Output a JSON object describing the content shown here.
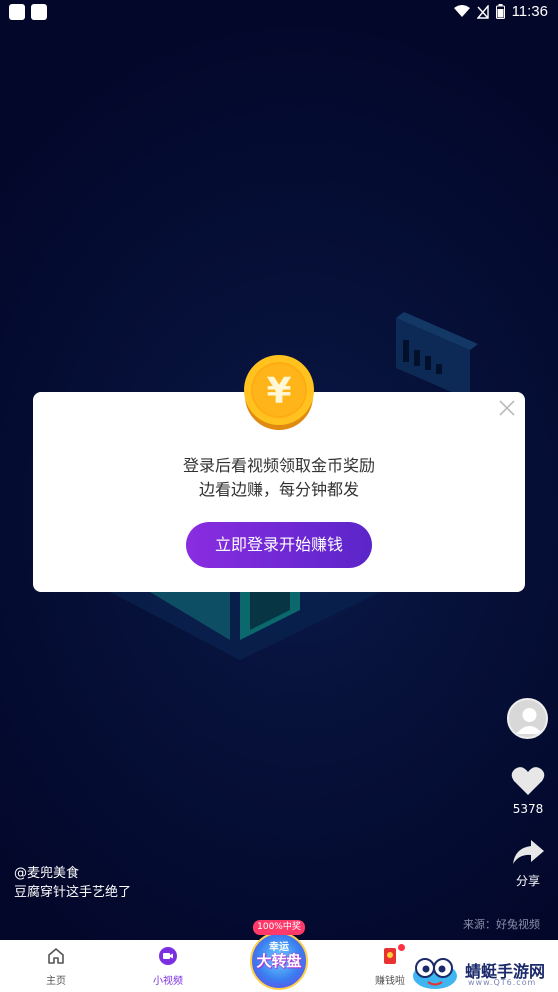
{
  "status_bar": {
    "time": "11:36"
  },
  "modal": {
    "line1": "登录后看视频领取金币奖励",
    "line2": "边看边赚，每分钟都发",
    "button_label": "立即登录开始赚钱"
  },
  "side_actions": {
    "like_count": "5378",
    "share_label": "分享"
  },
  "video": {
    "author": "@麦兜美食",
    "description": "豆腐穿针这手艺绝了",
    "source": "来源：好兔视频"
  },
  "nav": {
    "items": [
      {
        "label": "主页",
        "icon": "home-icon"
      },
      {
        "label": "小视频",
        "icon": "video-icon"
      },
      {
        "label": "赚钱啦",
        "icon": "red-envelope-icon"
      }
    ],
    "wheel_badge": "100%中奖",
    "wheel_line1": "幸运",
    "wheel_line2": "大转盘"
  },
  "watermark": {
    "name": "蜻蜓手游网",
    "url": "www.QT6.com"
  },
  "colors": {
    "accent": "#7b2fe0",
    "background": "#030829"
  }
}
